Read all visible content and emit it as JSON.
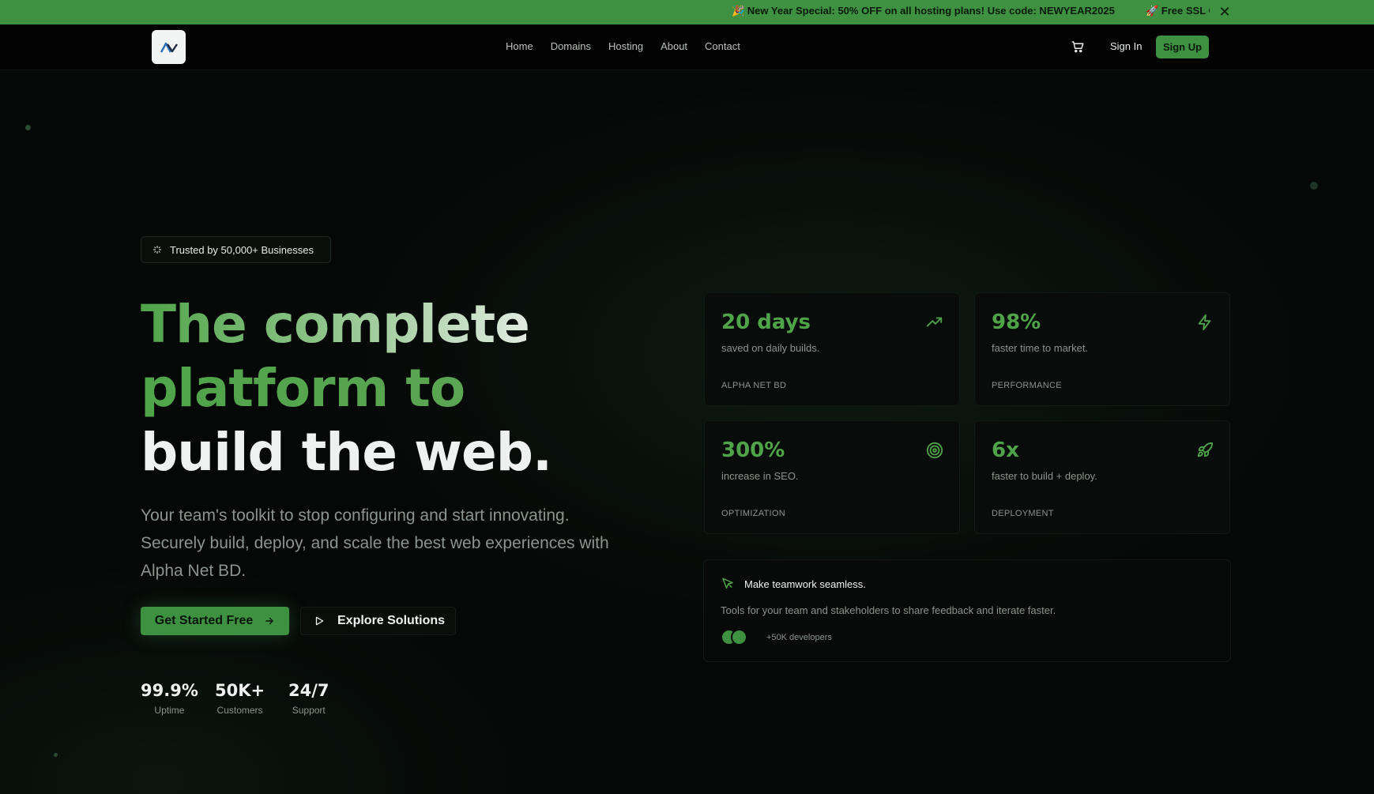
{
  "promo": {
    "message1": "🎉 New Year Special: 50% OFF on all hosting plans! Use code: NEWYEAR2025",
    "message2": "🚀 Free SSL Certificate with every hosting plan!",
    "close_icon": "close-icon"
  },
  "nav": {
    "logo_icon": "alpha-logo-icon",
    "links": [
      "Home",
      "Domains",
      "Hosting",
      "About",
      "Contact"
    ],
    "cart_icon": "cart-icon",
    "signin": "Sign In",
    "signup": "Sign Up"
  },
  "hero": {
    "trust_badge": "Trusted by 50,000+ Businesses",
    "headline_line1": "The complete",
    "headline_line2": "platform to",
    "headline_line3": "build the web.",
    "subtext": "Your team's toolkit to stop configuring and start innovating. Securely build, deploy, and scale the best web experiences with Alpha Net BD.",
    "cta_primary": "Get Started Free",
    "cta_secondary": "Explore Solutions",
    "stats": [
      {
        "value": "99.9%",
        "label": "Uptime"
      },
      {
        "value": "50K+",
        "label": "Customers"
      },
      {
        "value": "24/7",
        "label": "Support"
      }
    ]
  },
  "cards": [
    {
      "value": "20 days",
      "desc": "saved on daily builds.",
      "tag": "ALPHA NET BD",
      "icon": "trending-up-icon"
    },
    {
      "value": "98%",
      "desc": "faster time to market.",
      "tag": "PERFORMANCE",
      "icon": "lightning-icon"
    },
    {
      "value": "300%",
      "desc": "increase in SEO.",
      "tag": "OPTIMIZATION",
      "icon": "target-icon"
    },
    {
      "value": "6x",
      "desc": "faster to build + deploy.",
      "tag": "DEPLOYMENT",
      "icon": "rocket-icon"
    }
  ],
  "team": {
    "title": "Make teamwork seamless.",
    "desc": "Tools for your team and stakeholders to share feedback and iterate faster.",
    "count": "+50K developers",
    "icon": "cursor-pointer-icon"
  },
  "colors": {
    "accent": "#3f9142",
    "accent_text": "#4fa449",
    "background": "#050807",
    "muted": "#8b948e"
  }
}
